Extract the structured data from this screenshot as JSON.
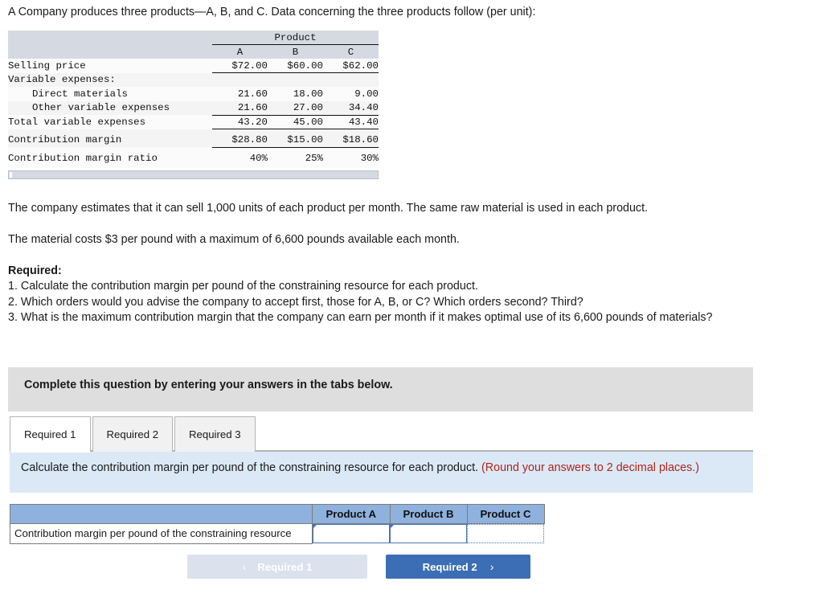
{
  "intro": "A Company produces three products—A, B, and C. Data concerning the three products follow (per unit):",
  "data_table": {
    "group_header": "Product",
    "columns": [
      "A",
      "B",
      "C"
    ],
    "rows": [
      {
        "label": "Selling price",
        "values": [
          "$72.00",
          "$60.00",
          "$62.00"
        ],
        "rule": "single"
      },
      {
        "label": "Variable expenses:",
        "values": [
          "",
          "",
          ""
        ],
        "rule": "none"
      },
      {
        "label": "Direct materials",
        "values": [
          "21.60",
          "18.00",
          "9.00"
        ],
        "rule": "none",
        "indent": true
      },
      {
        "label": "Other variable expenses",
        "values": [
          "21.60",
          "27.00",
          "34.40"
        ],
        "rule": "single",
        "indent": true
      },
      {
        "label": "Total variable expenses",
        "values": [
          "43.20",
          "45.00",
          "43.40"
        ],
        "rule": "single"
      },
      {
        "label": "Contribution margin",
        "values": [
          "$28.80",
          "$15.00",
          "$18.60"
        ],
        "rule": "double"
      },
      {
        "label": "Contribution margin ratio",
        "values": [
          "40%",
          "25%",
          "30%"
        ],
        "rule": "none"
      }
    ]
  },
  "paragraphs": {
    "p1": "The company estimates that it can sell 1,000 units of each product per month. The same raw material is used in each product.",
    "p2": "The material costs $3 per pound with a maximum of 6,600 pounds available each month."
  },
  "required": {
    "heading": "Required:",
    "items": [
      "1. Calculate the contribution margin per pound of the constraining resource for each product.",
      "2. Which orders would you advise the company to accept first, those for A, B, or C? Which orders second? Third?",
      "3. What is the maximum contribution margin that the company can earn per month if it makes optimal use of its 6,600 pounds of materials?"
    ]
  },
  "banner": {
    "text": "Complete this question by entering your answers in the tabs below."
  },
  "tabs": [
    {
      "label": "Required 1",
      "active": true
    },
    {
      "label": "Required 2",
      "active": false
    },
    {
      "label": "Required 3",
      "active": false
    }
  ],
  "instruction": {
    "main": "Calculate the contribution margin per pound of the constraining resource for each product.",
    "note": "(Round your answers to 2 decimal places.)",
    "note_color": "#b02418"
  },
  "answer_table": {
    "blank_header": "",
    "headers": [
      "Product A",
      "Product B",
      "Product C"
    ],
    "row_label": "Contribution margin per pound of the constraining resource",
    "values": [
      "",
      "",
      ""
    ],
    "placeholders": [
      "",
      "",
      ""
    ]
  },
  "nav": {
    "prev_label": "Required 1",
    "prev_chevron": "‹",
    "next_label": "Required 2",
    "next_chevron": "›",
    "next_color": "#3b6eb5",
    "prev_color": "#dbe2ed"
  }
}
